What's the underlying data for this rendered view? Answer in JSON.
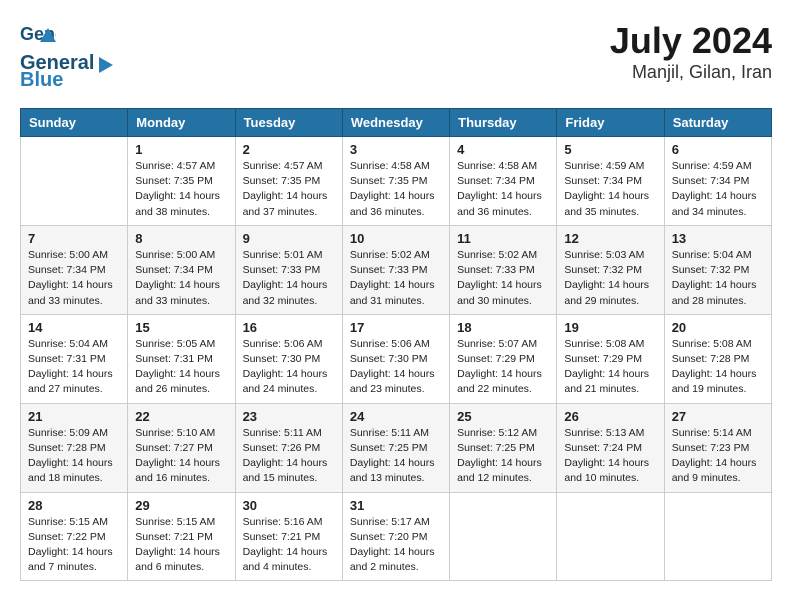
{
  "header": {
    "logo_line1": "General",
    "logo_line2": "Blue",
    "title": "July 2024",
    "subtitle": "Manjil, Gilan, Iran"
  },
  "days_of_week": [
    "Sunday",
    "Monday",
    "Tuesday",
    "Wednesday",
    "Thursday",
    "Friday",
    "Saturday"
  ],
  "weeks": [
    [
      {
        "day": "",
        "info": ""
      },
      {
        "day": "1",
        "info": "Sunrise: 4:57 AM\nSunset: 7:35 PM\nDaylight: 14 hours\nand 38 minutes."
      },
      {
        "day": "2",
        "info": "Sunrise: 4:57 AM\nSunset: 7:35 PM\nDaylight: 14 hours\nand 37 minutes."
      },
      {
        "day": "3",
        "info": "Sunrise: 4:58 AM\nSunset: 7:35 PM\nDaylight: 14 hours\nand 36 minutes."
      },
      {
        "day": "4",
        "info": "Sunrise: 4:58 AM\nSunset: 7:34 PM\nDaylight: 14 hours\nand 36 minutes."
      },
      {
        "day": "5",
        "info": "Sunrise: 4:59 AM\nSunset: 7:34 PM\nDaylight: 14 hours\nand 35 minutes."
      },
      {
        "day": "6",
        "info": "Sunrise: 4:59 AM\nSunset: 7:34 PM\nDaylight: 14 hours\nand 34 minutes."
      }
    ],
    [
      {
        "day": "7",
        "info": "Sunrise: 5:00 AM\nSunset: 7:34 PM\nDaylight: 14 hours\nand 33 minutes."
      },
      {
        "day": "8",
        "info": "Sunrise: 5:00 AM\nSunset: 7:34 PM\nDaylight: 14 hours\nand 33 minutes."
      },
      {
        "day": "9",
        "info": "Sunrise: 5:01 AM\nSunset: 7:33 PM\nDaylight: 14 hours\nand 32 minutes."
      },
      {
        "day": "10",
        "info": "Sunrise: 5:02 AM\nSunset: 7:33 PM\nDaylight: 14 hours\nand 31 minutes."
      },
      {
        "day": "11",
        "info": "Sunrise: 5:02 AM\nSunset: 7:33 PM\nDaylight: 14 hours\nand 30 minutes."
      },
      {
        "day": "12",
        "info": "Sunrise: 5:03 AM\nSunset: 7:32 PM\nDaylight: 14 hours\nand 29 minutes."
      },
      {
        "day": "13",
        "info": "Sunrise: 5:04 AM\nSunset: 7:32 PM\nDaylight: 14 hours\nand 28 minutes."
      }
    ],
    [
      {
        "day": "14",
        "info": "Sunrise: 5:04 AM\nSunset: 7:31 PM\nDaylight: 14 hours\nand 27 minutes."
      },
      {
        "day": "15",
        "info": "Sunrise: 5:05 AM\nSunset: 7:31 PM\nDaylight: 14 hours\nand 26 minutes."
      },
      {
        "day": "16",
        "info": "Sunrise: 5:06 AM\nSunset: 7:30 PM\nDaylight: 14 hours\nand 24 minutes."
      },
      {
        "day": "17",
        "info": "Sunrise: 5:06 AM\nSunset: 7:30 PM\nDaylight: 14 hours\nand 23 minutes."
      },
      {
        "day": "18",
        "info": "Sunrise: 5:07 AM\nSunset: 7:29 PM\nDaylight: 14 hours\nand 22 minutes."
      },
      {
        "day": "19",
        "info": "Sunrise: 5:08 AM\nSunset: 7:29 PM\nDaylight: 14 hours\nand 21 minutes."
      },
      {
        "day": "20",
        "info": "Sunrise: 5:08 AM\nSunset: 7:28 PM\nDaylight: 14 hours\nand 19 minutes."
      }
    ],
    [
      {
        "day": "21",
        "info": "Sunrise: 5:09 AM\nSunset: 7:28 PM\nDaylight: 14 hours\nand 18 minutes."
      },
      {
        "day": "22",
        "info": "Sunrise: 5:10 AM\nSunset: 7:27 PM\nDaylight: 14 hours\nand 16 minutes."
      },
      {
        "day": "23",
        "info": "Sunrise: 5:11 AM\nSunset: 7:26 PM\nDaylight: 14 hours\nand 15 minutes."
      },
      {
        "day": "24",
        "info": "Sunrise: 5:11 AM\nSunset: 7:25 PM\nDaylight: 14 hours\nand 13 minutes."
      },
      {
        "day": "25",
        "info": "Sunrise: 5:12 AM\nSunset: 7:25 PM\nDaylight: 14 hours\nand 12 minutes."
      },
      {
        "day": "26",
        "info": "Sunrise: 5:13 AM\nSunset: 7:24 PM\nDaylight: 14 hours\nand 10 minutes."
      },
      {
        "day": "27",
        "info": "Sunrise: 5:14 AM\nSunset: 7:23 PM\nDaylight: 14 hours\nand 9 minutes."
      }
    ],
    [
      {
        "day": "28",
        "info": "Sunrise: 5:15 AM\nSunset: 7:22 PM\nDaylight: 14 hours\nand 7 minutes."
      },
      {
        "day": "29",
        "info": "Sunrise: 5:15 AM\nSunset: 7:21 PM\nDaylight: 14 hours\nand 6 minutes."
      },
      {
        "day": "30",
        "info": "Sunrise: 5:16 AM\nSunset: 7:21 PM\nDaylight: 14 hours\nand 4 minutes."
      },
      {
        "day": "31",
        "info": "Sunrise: 5:17 AM\nSunset: 7:20 PM\nDaylight: 14 hours\nand 2 minutes."
      },
      {
        "day": "",
        "info": ""
      },
      {
        "day": "",
        "info": ""
      },
      {
        "day": "",
        "info": ""
      }
    ]
  ]
}
